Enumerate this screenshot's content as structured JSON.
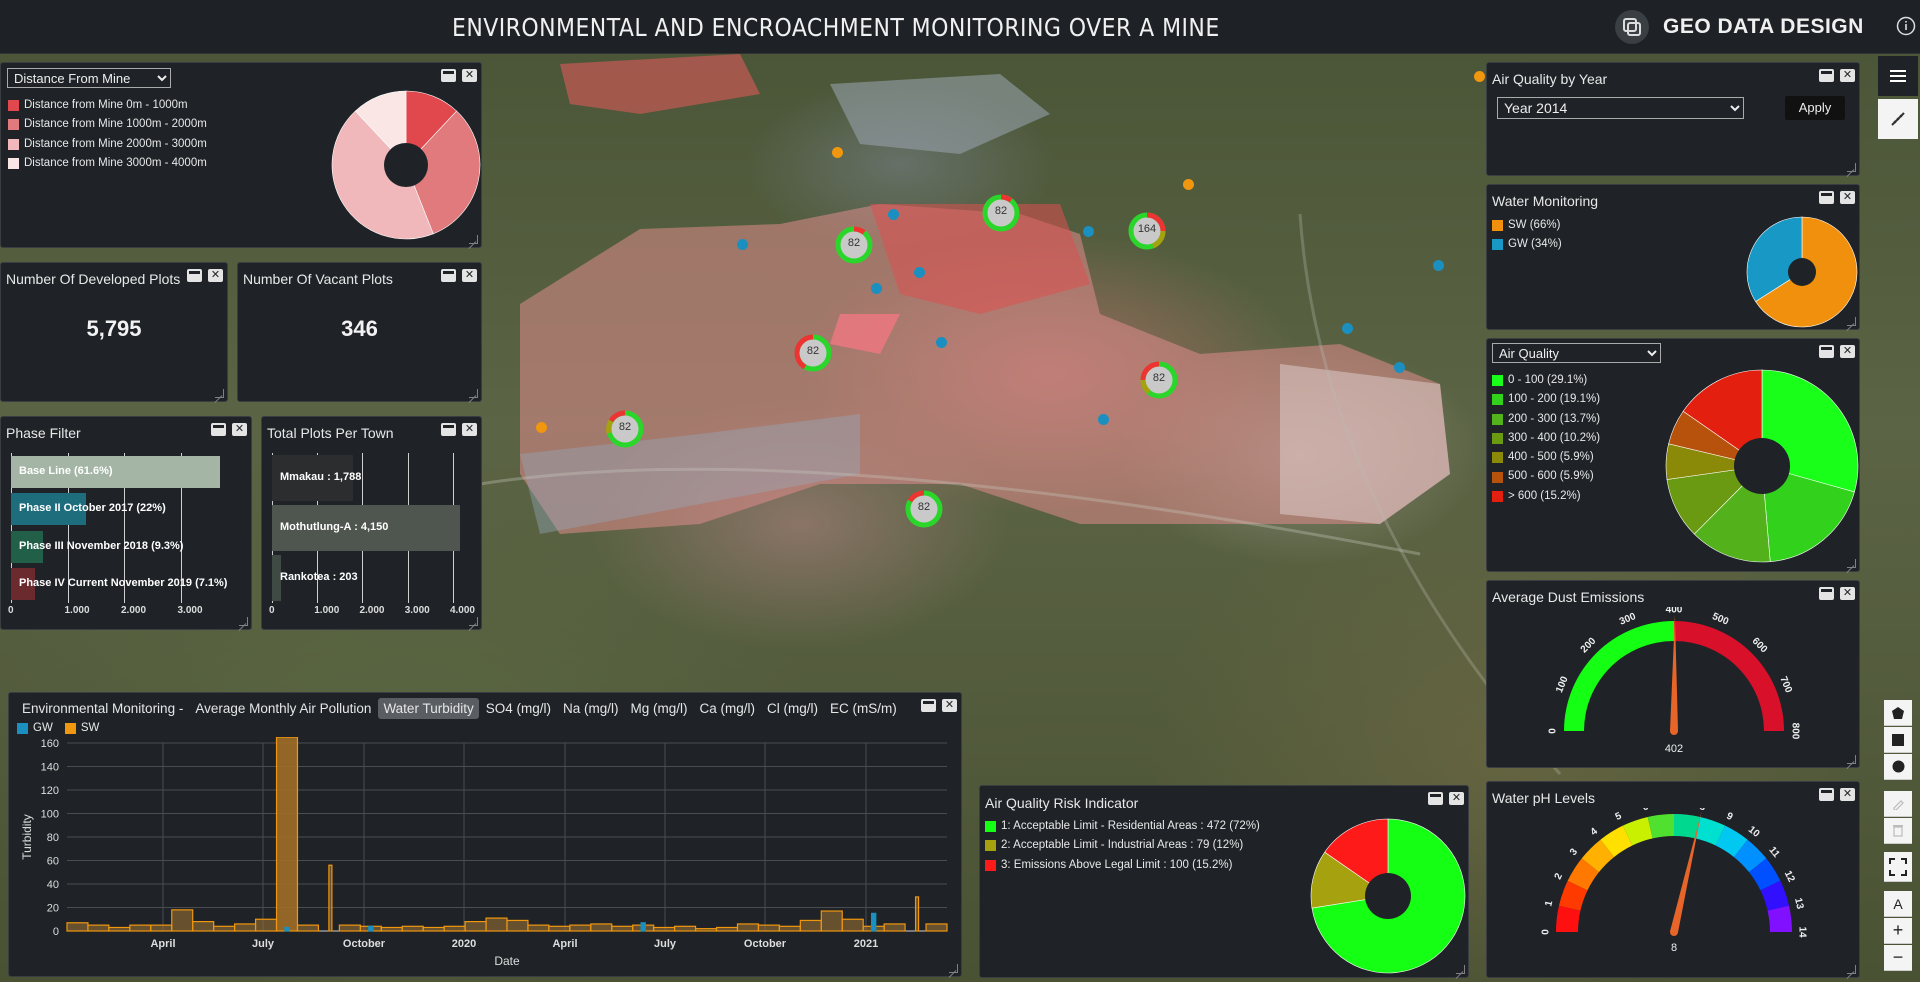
{
  "header": {
    "title": "ENVIRONMENTAL AND ENCROACHMENT MONITORING OVER A MINE",
    "brand": "GEO DATA DESIGN",
    "info_icon": "info-icon"
  },
  "distance_panel": {
    "select_value": "Distance From Mine",
    "legend": [
      {
        "label": "Distance from Mine 0m - 1000m",
        "color": "#e0484e",
        "value": 12
      },
      {
        "label": "Distance from Mine 1000m - 2000m",
        "color": "#e07a7c",
        "value": 32
      },
      {
        "label": "Distance from Mine 2000m - 3000m",
        "color": "#f0b8ba",
        "value": 44
      },
      {
        "label": "Distance from Mine 3000m - 4000m",
        "color": "#fbe6e6",
        "value": 12
      }
    ]
  },
  "developed_plots": {
    "title": "Number Of Developed Plots",
    "value": "5,795"
  },
  "vacant_plots": {
    "title": "Number Of Vacant Plots",
    "value": "346"
  },
  "phase_filter": {
    "title": "Phase Filter",
    "bars": [
      {
        "label": "Base Line (61.6%)",
        "value": 3700,
        "color": "#a4b5a5"
      },
      {
        "label": "Phase II October 2017 (22%)",
        "value": 1330,
        "color": "#1e6d7c"
      },
      {
        "label": "Phase III November 2018 (9.3%)",
        "value": 560,
        "color": "#215f48"
      },
      {
        "label": "Phase IV Current November 2019 (7.1%)",
        "value": 430,
        "color": "#6b2a2e"
      }
    ],
    "ticks": [
      "0",
      "1.000",
      "2.000",
      "3.000"
    ]
  },
  "plots_per_town": {
    "title": "Total Plots Per Town",
    "bars": [
      {
        "label": "Mmakau : 1,788",
        "value": 1788,
        "color": "#2b2d2e"
      },
      {
        "label": "Mothutlung-A : 4,150",
        "value": 4150,
        "color": "#4f5650"
      },
      {
        "label": "Rankotea : 203",
        "value": 203,
        "color": "#3f4a44"
      }
    ],
    "ticks": [
      "0",
      "1.000",
      "2.000",
      "3.000",
      "4.000"
    ]
  },
  "env_monitoring": {
    "tabs": [
      "Environmental Monitoring -",
      "Average Monthly Air Pollution",
      "Water Turbidity",
      "SO4 (mg/l)",
      "Na (mg/l)",
      "Mg (mg/l)",
      "Ca (mg/l)",
      "Cl (mg/l)",
      "EC (mS/m)"
    ],
    "active_tab": "Water Turbidity",
    "legend": [
      {
        "label": "GW",
        "color": "#1a8fc0"
      },
      {
        "label": "SW",
        "color": "#f0960f"
      }
    ]
  },
  "chart_data": {
    "type": "bar",
    "title": "",
    "xlabel": "Date",
    "ylabel": "Turbidity",
    "ylim": [
      0,
      160
    ],
    "yticks": [
      "0",
      "20",
      "40",
      "60",
      "80",
      "100",
      "120",
      "140",
      "160"
    ],
    "xticks": [
      "April",
      "July",
      "October",
      "2020",
      "April",
      "July",
      "October",
      "2021"
    ],
    "grid": true,
    "legend_position": "top-left",
    "series": [
      {
        "name": "SW",
        "color": "#f0960f",
        "values": [
          7,
          5,
          3,
          5,
          5,
          18,
          8,
          4,
          6,
          10,
          165,
          5,
          56,
          5,
          4,
          3,
          4,
          3,
          4,
          8,
          11,
          9,
          5,
          4,
          5,
          6,
          4,
          5,
          3,
          4,
          2,
          3,
          6,
          5,
          4,
          9,
          17,
          10,
          4,
          6,
          29,
          6
        ]
      },
      {
        "name": "GW",
        "color": "#1a8fc0",
        "values": [
          0,
          0,
          0,
          0,
          0,
          0,
          0,
          0,
          0,
          0,
          3,
          0,
          0,
          0,
          4,
          0,
          0,
          0,
          0,
          0,
          0,
          0,
          0,
          0,
          0,
          0,
          0,
          7,
          0,
          0,
          0,
          0,
          0,
          0,
          0,
          0,
          0,
          0,
          15,
          0,
          0,
          0
        ]
      }
    ]
  },
  "air_risk": {
    "title": "Air Quality Risk Indicator",
    "legend": [
      {
        "label": "1: Acceptable Limit - Residential Areas : 472 (72%)",
        "color": "#14ff14",
        "value": 472
      },
      {
        "label": "2: Acceptable Limit - Industrial Areas : 79 (12%)",
        "color": "#a6a20f",
        "value": 79
      },
      {
        "label": "3: Emissions Above Legal Limit : 100 (15.2%)",
        "color": "#ff1a1a",
        "value": 100
      }
    ]
  },
  "air_by_year": {
    "title": "Air Quality by Year",
    "select_value": "Year 2014",
    "apply_label": "Apply"
  },
  "water_monitoring": {
    "title": "Water Monitoring",
    "legend": [
      {
        "label": "SW (66%)",
        "color": "#f0900c",
        "value": 66
      },
      {
        "label": "GW (34%)",
        "color": "#1898c4",
        "value": 34
      }
    ]
  },
  "air_quality": {
    "select_value": "Air Quality",
    "legend": [
      {
        "label": "0 - 100 (29.1%)",
        "color": "#1aff1a",
        "value": 29.1
      },
      {
        "label": "100 - 200 (19.1%)",
        "color": "#32d21c",
        "value": 19.1
      },
      {
        "label": "200 - 300 (13.7%)",
        "color": "#53b21c",
        "value": 13.7
      },
      {
        "label": "300 - 400 (10.2%)",
        "color": "#6a9a12",
        "value": 10.2
      },
      {
        "label": "400 - 500 (5.9%)",
        "color": "#8a8a08",
        "value": 5.9
      },
      {
        "label": "500 - 600 (5.9%)",
        "color": "#b6520c",
        "value": 5.9
      },
      {
        "label": "> 600 (15.2%)",
        "color": "#e3200f",
        "value": 15.2
      }
    ]
  },
  "dust_gauge": {
    "title": "Average Dust Emissions",
    "min": 0,
    "max": 800,
    "value": 402,
    "value_label": "402",
    "ticks": [
      "0",
      "100",
      "200",
      "300",
      "400",
      "500",
      "600",
      "700",
      "800"
    ]
  },
  "ph_gauge": {
    "title": "Water pH Levels",
    "min": 0,
    "max": 14,
    "value": 8,
    "value_label": "8",
    "ticks": [
      "0",
      "1",
      "2",
      "3",
      "4",
      "5",
      "6",
      "7",
      "8",
      "9",
      "10",
      "11",
      "12",
      "13",
      "14"
    ]
  },
  "map_markers": [
    {
      "label": "82"
    },
    {
      "label": "164"
    },
    {
      "label": "82"
    },
    {
      "label": "82"
    },
    {
      "label": "82"
    },
    {
      "label": "82"
    },
    {
      "label": "82"
    }
  ],
  "toolbar": {
    "menu_icon": "menu-icon",
    "measure_icon": "ruler-icon",
    "tools": [
      "polygon-icon",
      "square-icon",
      "circle-icon",
      "edit-icon",
      "delete-icon",
      "fullscreen-icon",
      "north-arrow-icon",
      "zoom-in-icon",
      "zoom-out-icon"
    ],
    "zoom_in": "+",
    "zoom_out": "−",
    "north": "A"
  }
}
